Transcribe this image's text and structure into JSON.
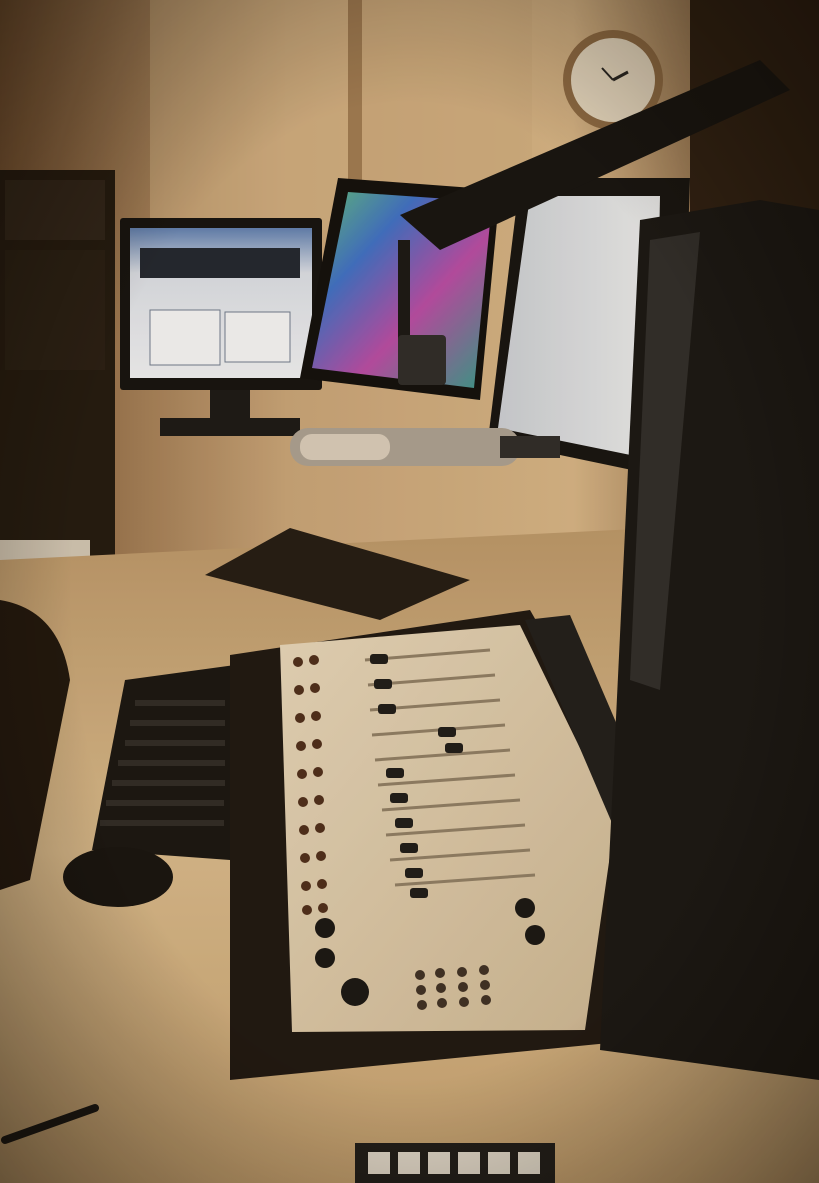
{
  "scene": {
    "description_colors": {
      "wall": "#c9a77a",
      "wall_dark": "#6b4a2c",
      "desk": "#d9bd92",
      "console_face": "#e9dcc4",
      "monitor_frame": "#151515"
    }
  }
}
